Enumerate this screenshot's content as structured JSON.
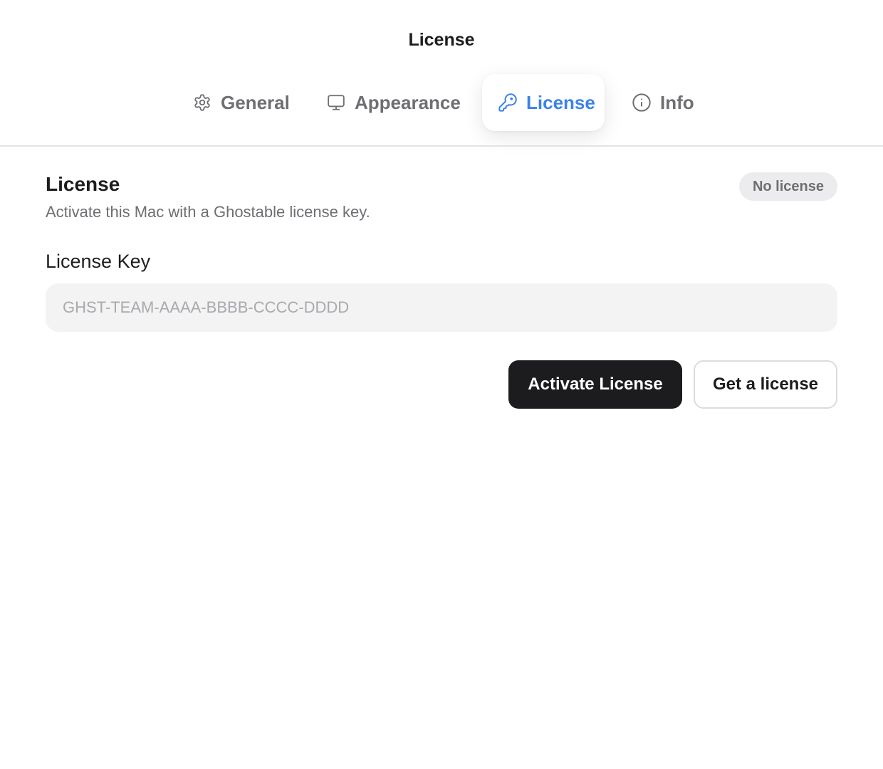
{
  "window": {
    "title": "License"
  },
  "tabs": [
    {
      "label": "General",
      "icon": "gear-icon",
      "selected": false
    },
    {
      "label": "Appearance",
      "icon": "monitor-icon",
      "selected": false
    },
    {
      "label": "License",
      "icon": "key-icon",
      "selected": true
    },
    {
      "label": "Info",
      "icon": "info-icon",
      "selected": false
    }
  ],
  "license": {
    "title": "License",
    "subtitle": "Activate this Mac with a Ghostable license key.",
    "status": "No license",
    "key_label": "License Key",
    "key_value": "",
    "key_placeholder": "GHST-TEAM-AAAA-BBBB-CCCC-DDDD",
    "activate_label": "Activate License",
    "get_label": "Get a license"
  },
  "colors": {
    "accent": "#3b82e6",
    "primary_button": "#1c1c1e",
    "badge_bg": "#ececee",
    "input_bg": "#f3f3f4"
  }
}
